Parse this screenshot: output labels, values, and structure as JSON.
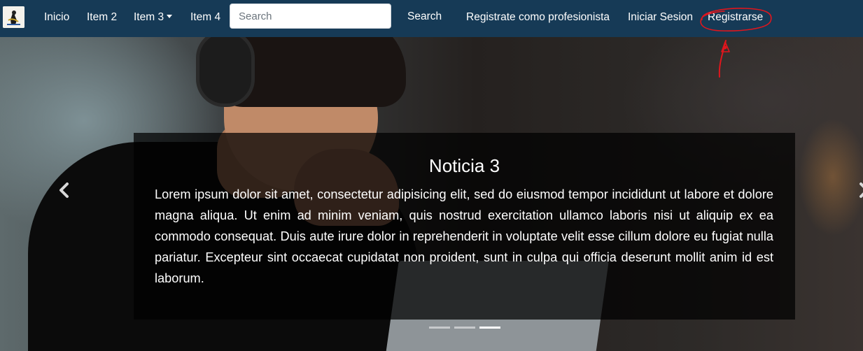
{
  "navbar": {
    "logo_icon": "brand-logo-icon",
    "items": [
      {
        "label": "Inicio"
      },
      {
        "label": "Item 2"
      },
      {
        "label": "Item 3",
        "dropdown": true
      },
      {
        "label": "Item 4"
      }
    ],
    "search": {
      "placeholder": "Search",
      "value": "",
      "button_label": "Search"
    },
    "right_items": [
      {
        "label": "Registrate como profesionista"
      },
      {
        "label": "Iniciar Sesion"
      },
      {
        "label": "Registrarse"
      }
    ],
    "colors": {
      "background": "#163a56",
      "text": "#ffffff",
      "annotation": "#e0161d"
    }
  },
  "carousel": {
    "active_slide": {
      "title": "Noticia 3",
      "text": "Lorem ipsum dolor sit amet, consectetur adipisicing elit, sed do eiusmod tempor incididunt ut labore et dolore magna aliqua. Ut enim ad minim veniam, quis nostrud exercitation ullamco laboris nisi ut aliquip ex ea commodo consequat. Duis aute irure dolor in reprehenderit in voluptate velit esse cillum dolore eu fugiat nulla pariatur. Excepteur sint occaecat cupidatat non proident, sunt in culpa qui officia deserunt mollit anim id est laborum."
    },
    "indicators": 3,
    "active_indicator": 3,
    "prev_icon": "chevron-left-icon",
    "next_icon": "chevron-right-icon"
  }
}
